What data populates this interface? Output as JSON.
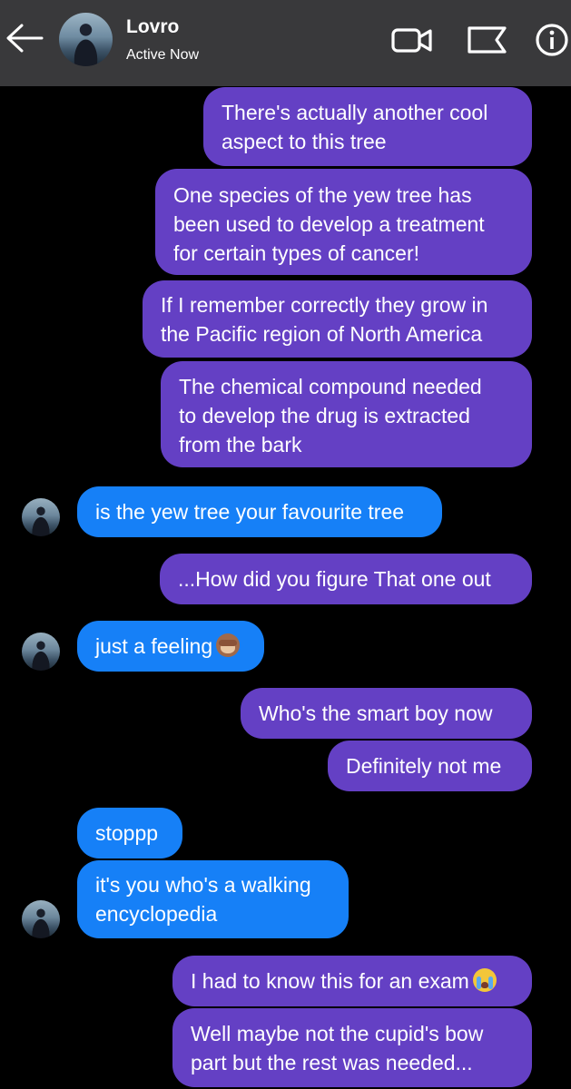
{
  "header": {
    "contact_name": "Lovro",
    "status": "Active Now",
    "icons": [
      "back-arrow-icon",
      "video-call-icon",
      "flag-icon",
      "info-icon"
    ]
  },
  "messages": [
    {
      "side": "out",
      "lines": [
        "There's actually another cool",
        "aspect to this tree"
      ]
    },
    {
      "side": "out",
      "lines": [
        "One species of the yew tree has",
        "been used to develop a treatment",
        "for certain types of cancer!"
      ]
    },
    {
      "side": "out",
      "lines": [
        "If I remember correctly they grow in",
        "the Pacific region of North America"
      ]
    },
    {
      "side": "out",
      "lines": [
        "The chemical compound needed",
        "to develop the drug is extracted",
        "from the bark"
      ]
    },
    {
      "side": "in",
      "lines": [
        "is the yew tree your favourite tree"
      ]
    },
    {
      "side": "out",
      "lines": [
        "...How did you figure That one out"
      ]
    },
    {
      "side": "in",
      "lines": [
        "just a feeling"
      ],
      "emoji": "see-no-evil-monkey"
    },
    {
      "side": "out",
      "lines": [
        "Who's the smart boy now"
      ]
    },
    {
      "side": "out",
      "lines": [
        "Definitely not me"
      ]
    },
    {
      "side": "in",
      "lines": [
        "stoppp"
      ]
    },
    {
      "side": "in",
      "lines": [
        "it's you who's a walking",
        "encyclopedia"
      ]
    },
    {
      "side": "out",
      "lines": [
        "I had to know this for an exam"
      ],
      "emoji": "loudly-crying-face"
    },
    {
      "side": "out",
      "lines": [
        "Well maybe not the cupid's bow",
        "part but the rest was needed..."
      ]
    }
  ],
  "colors": {
    "header_bg": "#39393b",
    "outgoing_bubble": "#6440c4",
    "incoming_bubble": "#1680f7",
    "background": "#000000"
  }
}
